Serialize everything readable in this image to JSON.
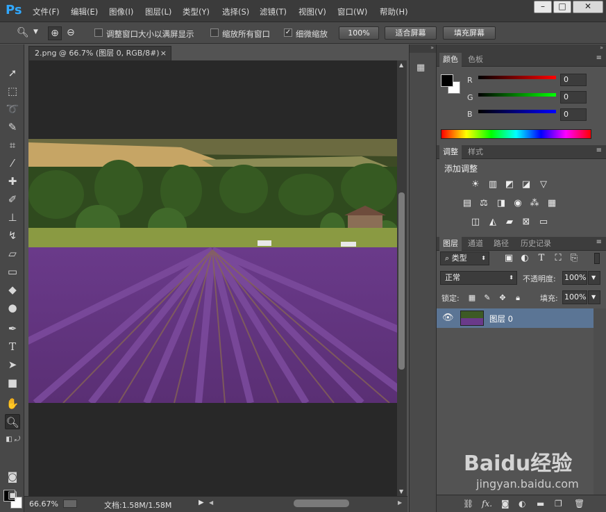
{
  "app": {
    "logo": "Ps"
  },
  "menu": [
    "文件(F)",
    "编辑(E)",
    "图像(I)",
    "图层(L)",
    "类型(Y)",
    "选择(S)",
    "滤镜(T)",
    "视图(V)",
    "窗口(W)",
    "帮助(H)"
  ],
  "window_buttons": {
    "minimize": "–",
    "maximize": "□",
    "close": "✕"
  },
  "options": {
    "resize_windows": "调整窗口大小以满屏显示",
    "zoom_all": "缩放所有窗口",
    "scrubby_zoom": "细微缩放",
    "zoom_100": "100%",
    "fit_screen": "适合屏幕",
    "fill_screen": "填充屏幕",
    "resize_checked": false,
    "zoom_all_checked": false,
    "scrubby_checked": true
  },
  "document": {
    "tab_title": "2.png @ 66.7% (图层 0, RGB/8#)",
    "close": "×"
  },
  "status": {
    "zoom": "66.67%",
    "doc_size": "文档:1.58M/1.58M"
  },
  "color_panel": {
    "tabs": [
      "颜色",
      "色板"
    ],
    "r_label": "R",
    "g_label": "G",
    "b_label": "B",
    "r_value": "0",
    "g_value": "0",
    "b_value": "0"
  },
  "adjustments_panel": {
    "tabs": [
      "调整",
      "样式"
    ],
    "heading": "添加调整"
  },
  "layers_panel": {
    "tabs": [
      "图层",
      "通道",
      "路径",
      "历史记录"
    ],
    "filter_kind": "类型",
    "blend_mode": "正常",
    "opacity_label": "不透明度:",
    "opacity_value": "100%",
    "lock_label": "锁定:",
    "fill_label": "填充:",
    "fill_value": "100%",
    "layers": [
      {
        "name": "图层 0"
      }
    ]
  },
  "watermark": {
    "logo": "Baidu经验",
    "url": "jingyan.baidu.com"
  },
  "colors": {
    "foreground": "#000000",
    "background": "#ffffff",
    "selected_layer": "#5b7595",
    "ps_blue": "#31a8ff"
  }
}
